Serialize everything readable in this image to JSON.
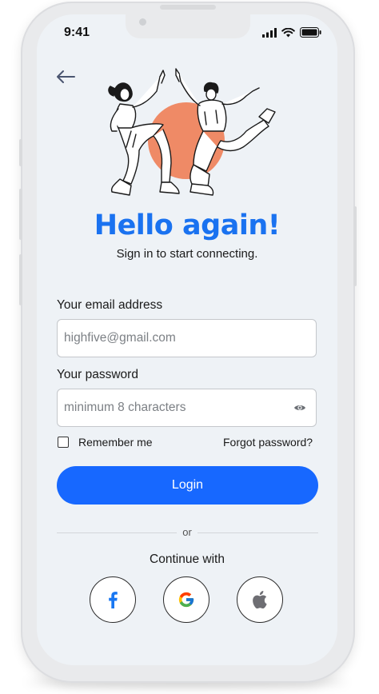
{
  "status_bar": {
    "time": "9:41"
  },
  "header": {
    "title": "Hello again!",
    "subtitle": "Sign in to start connecting."
  },
  "form": {
    "email_label": "Your email address",
    "email_placeholder": "highfive@gmail.com",
    "password_label": "Your password",
    "password_placeholder": "minimum 8 characters",
    "remember_label": "Remember me",
    "remember_checked": false,
    "forgot_label": "Forgot password?",
    "login_label": "Login"
  },
  "alt_login": {
    "or_text": "or",
    "continue_text": "Continue with",
    "providers": [
      {
        "name": "facebook",
        "icon": "facebook-icon",
        "color": "#1877f2"
      },
      {
        "name": "google",
        "icon": "google-icon",
        "color": "#4285f4"
      },
      {
        "name": "apple",
        "icon": "apple-icon",
        "color": "#6e6e73"
      }
    ]
  },
  "colors": {
    "accent": "#1768ff",
    "title": "#1a72f0",
    "illustration_accent": "#ef8a66",
    "screen_bg": "#eef2f6"
  }
}
